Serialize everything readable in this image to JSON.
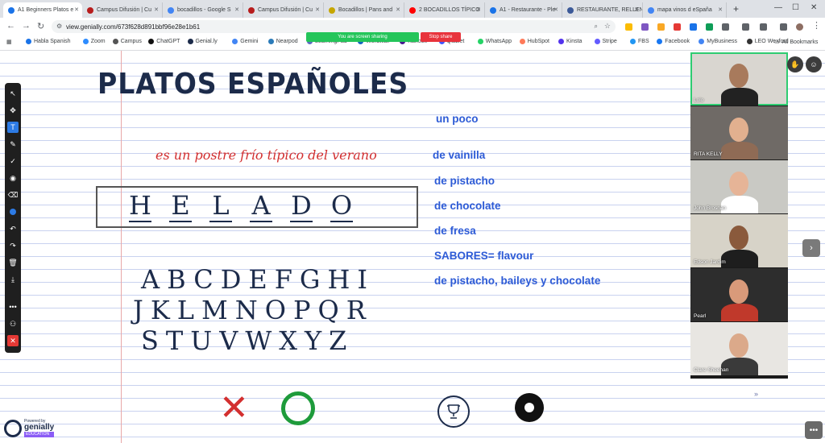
{
  "browser": {
    "tabs": [
      {
        "label": "A1 Beginners Platos e",
        "color": "#1a73e8",
        "active": true
      },
      {
        "label": "Campus Difusión | Cu",
        "color": "#b71c1c"
      },
      {
        "label": "bocadillos - Google S",
        "color": "#4285f4"
      },
      {
        "label": "Campus Difusión | Cu",
        "color": "#b71c1c"
      },
      {
        "label": "Bocadillos | Pans and",
        "color": "#c6a600"
      },
      {
        "label": "2 BOCADILLOS TÍPICO",
        "color": "#ff0000"
      },
      {
        "label": "A1 - Restaurante - Ple",
        "color": "#1a73e8"
      },
      {
        "label": "RESTAURANTE, RELLEN",
        "color": "#3b5998"
      },
      {
        "label": "mapa vinos d eSpaña",
        "color": "#4285f4"
      }
    ],
    "new_tab": "+",
    "url": "view.genially.com/673f628d891bbf96e28e1b61",
    "bookmarks": [
      {
        "label": "Habla Spanish",
        "color": "#1a73e8"
      },
      {
        "label": "Zoom",
        "color": "#2d8cff"
      },
      {
        "label": "Campus",
        "color": "#555555"
      },
      {
        "label": "ChatGPT",
        "color": "#111111"
      },
      {
        "label": "Genial.ly",
        "color": "#1c2b4a"
      },
      {
        "label": "Gemini",
        "color": "#4285f4"
      },
      {
        "label": "Nearpod",
        "color": "#2b7bb9"
      },
      {
        "label": "LearningPad",
        "color": "#5c6bc0"
      },
      {
        "label": "Wordwall",
        "color": "#1565c0"
      },
      {
        "label": "Kahoot!",
        "color": "#46178f"
      },
      {
        "label": "Quizlet",
        "color": "#4255ff"
      },
      {
        "label": "WhatsApp",
        "color": "#25d366"
      },
      {
        "label": "HubSpot",
        "color": "#ff7a59"
      },
      {
        "label": "Kinsta",
        "color": "#5333ed"
      },
      {
        "label": "Stripe",
        "color": "#635bff"
      },
      {
        "label": "FBS",
        "color": "#2196f3"
      },
      {
        "label": "Facebook",
        "color": "#1877f2"
      },
      {
        "label": "MyBusiness",
        "color": "#4285f4"
      },
      {
        "label": "LEO Wexford",
        "color": "#333333"
      }
    ],
    "all_bookmarks": "All Bookmarks",
    "sharing_text": "You are screen sharing",
    "stop_share": "Stop share"
  },
  "slide": {
    "title": "PLATOS ESPAÑOLES",
    "phrase": "es un postre frío típico del verano",
    "word_letters": [
      "H",
      "E",
      "L",
      "A",
      "D",
      "O"
    ],
    "alphabet_rows": [
      "ABCDEFGHI",
      "JKLMNOPQR",
      "STUVWXYZ"
    ],
    "options": [
      "un poco",
      "de vainilla",
      "de pistacho",
      "de chocolate",
      "de fresa",
      "SABORES= flavour",
      "de pistacho, baileys y chocolate"
    ],
    "colors": {
      "title": "#1c2b4a",
      "phrase": "#d32f2f",
      "options": "#2d5bd6",
      "wrong": "#d32f2f",
      "right": "#1e9b3b"
    },
    "icons": [
      "close-icon",
      "circle-icon",
      "trophy-icon",
      "record-icon"
    ]
  },
  "branding": {
    "powered_by": "Powered by",
    "name": "genially",
    "edition": "EDUCATION"
  },
  "participants": [
    {
      "name": "Lolo",
      "bg": "#d9d6d0",
      "skin": "#a87a5c",
      "shirt": "#222222"
    },
    {
      "name": "RITA KELLY",
      "bg": "#6f6a66",
      "skin": "#e2b08f",
      "shirt": "#8f6b55"
    },
    {
      "name": "John Brosnan",
      "bg": "#c9c9c4",
      "skin": "#e6b497",
      "shirt": "#ffffff"
    },
    {
      "name": "Edson Jardim",
      "bg": "#d7d3c8",
      "skin": "#8a5a3c",
      "shirt": "#1e1e1e"
    },
    {
      "name": "Pearl",
      "bg": "#2d2d2d",
      "skin": "#d99a7a",
      "shirt": "#c0392b"
    },
    {
      "name": "Clare Sheehan",
      "bg": "#e8e6e2",
      "skin": "#dba98a",
      "shirt": "#3a3a3a"
    }
  ]
}
